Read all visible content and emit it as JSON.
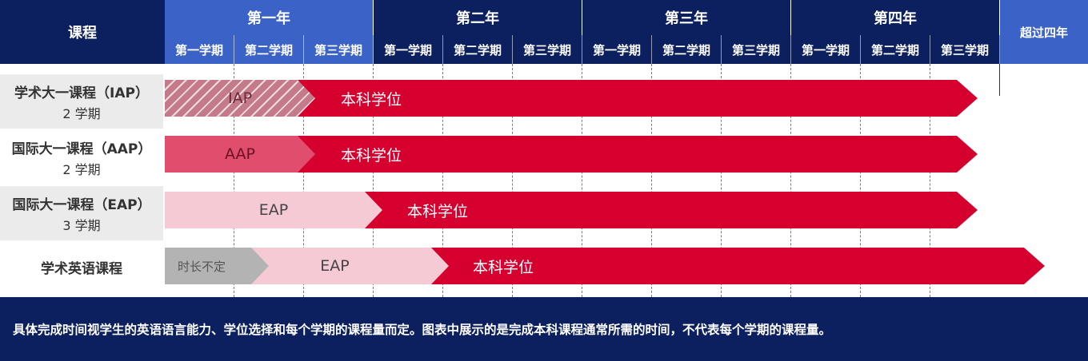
{
  "header": {
    "course_label": "课程",
    "years": [
      "第一年",
      "第二年",
      "第三年",
      "第四年"
    ],
    "semesters": [
      "第一学期",
      "第二学期",
      "第三学期",
      "第一学期",
      "第二学期",
      "第三学期",
      "第一学期",
      "第二学期",
      "第三学期",
      "第一学期",
      "第二学期",
      "第三学期"
    ],
    "beyond": "超过四年"
  },
  "rows": [
    {
      "name": "学术大一课程（IAP）",
      "duration": "2 学期",
      "pre_label": "IAP",
      "main_label": "本科学位"
    },
    {
      "name": "国际大一课程（AAP）",
      "duration": "2 学期",
      "pre_label": "AAP",
      "main_label": "本科学位"
    },
    {
      "name": "国际大一课程（EAP）",
      "duration": "3 学期",
      "pre_label": "EAP",
      "main_label": "本科学位"
    },
    {
      "name": "学术英语课程",
      "grey_label": "时长不定",
      "pre_label": "EAP",
      "main_label": "本科学位"
    }
  ],
  "footer": "具体完成时间视学生的英语语言能力、学位选择和每个学期的课程量而定。图表中展示的是完成本科课程通常所需的时间，不代表每个学期的课程量。",
  "colors": {
    "navy": "#0c1f5e",
    "blue": "#3b62c6",
    "red": "#d6002f",
    "pink_light": "#f5cad4",
    "pink_mid": "#e04d6d",
    "grey": "#b3b3b3"
  }
}
